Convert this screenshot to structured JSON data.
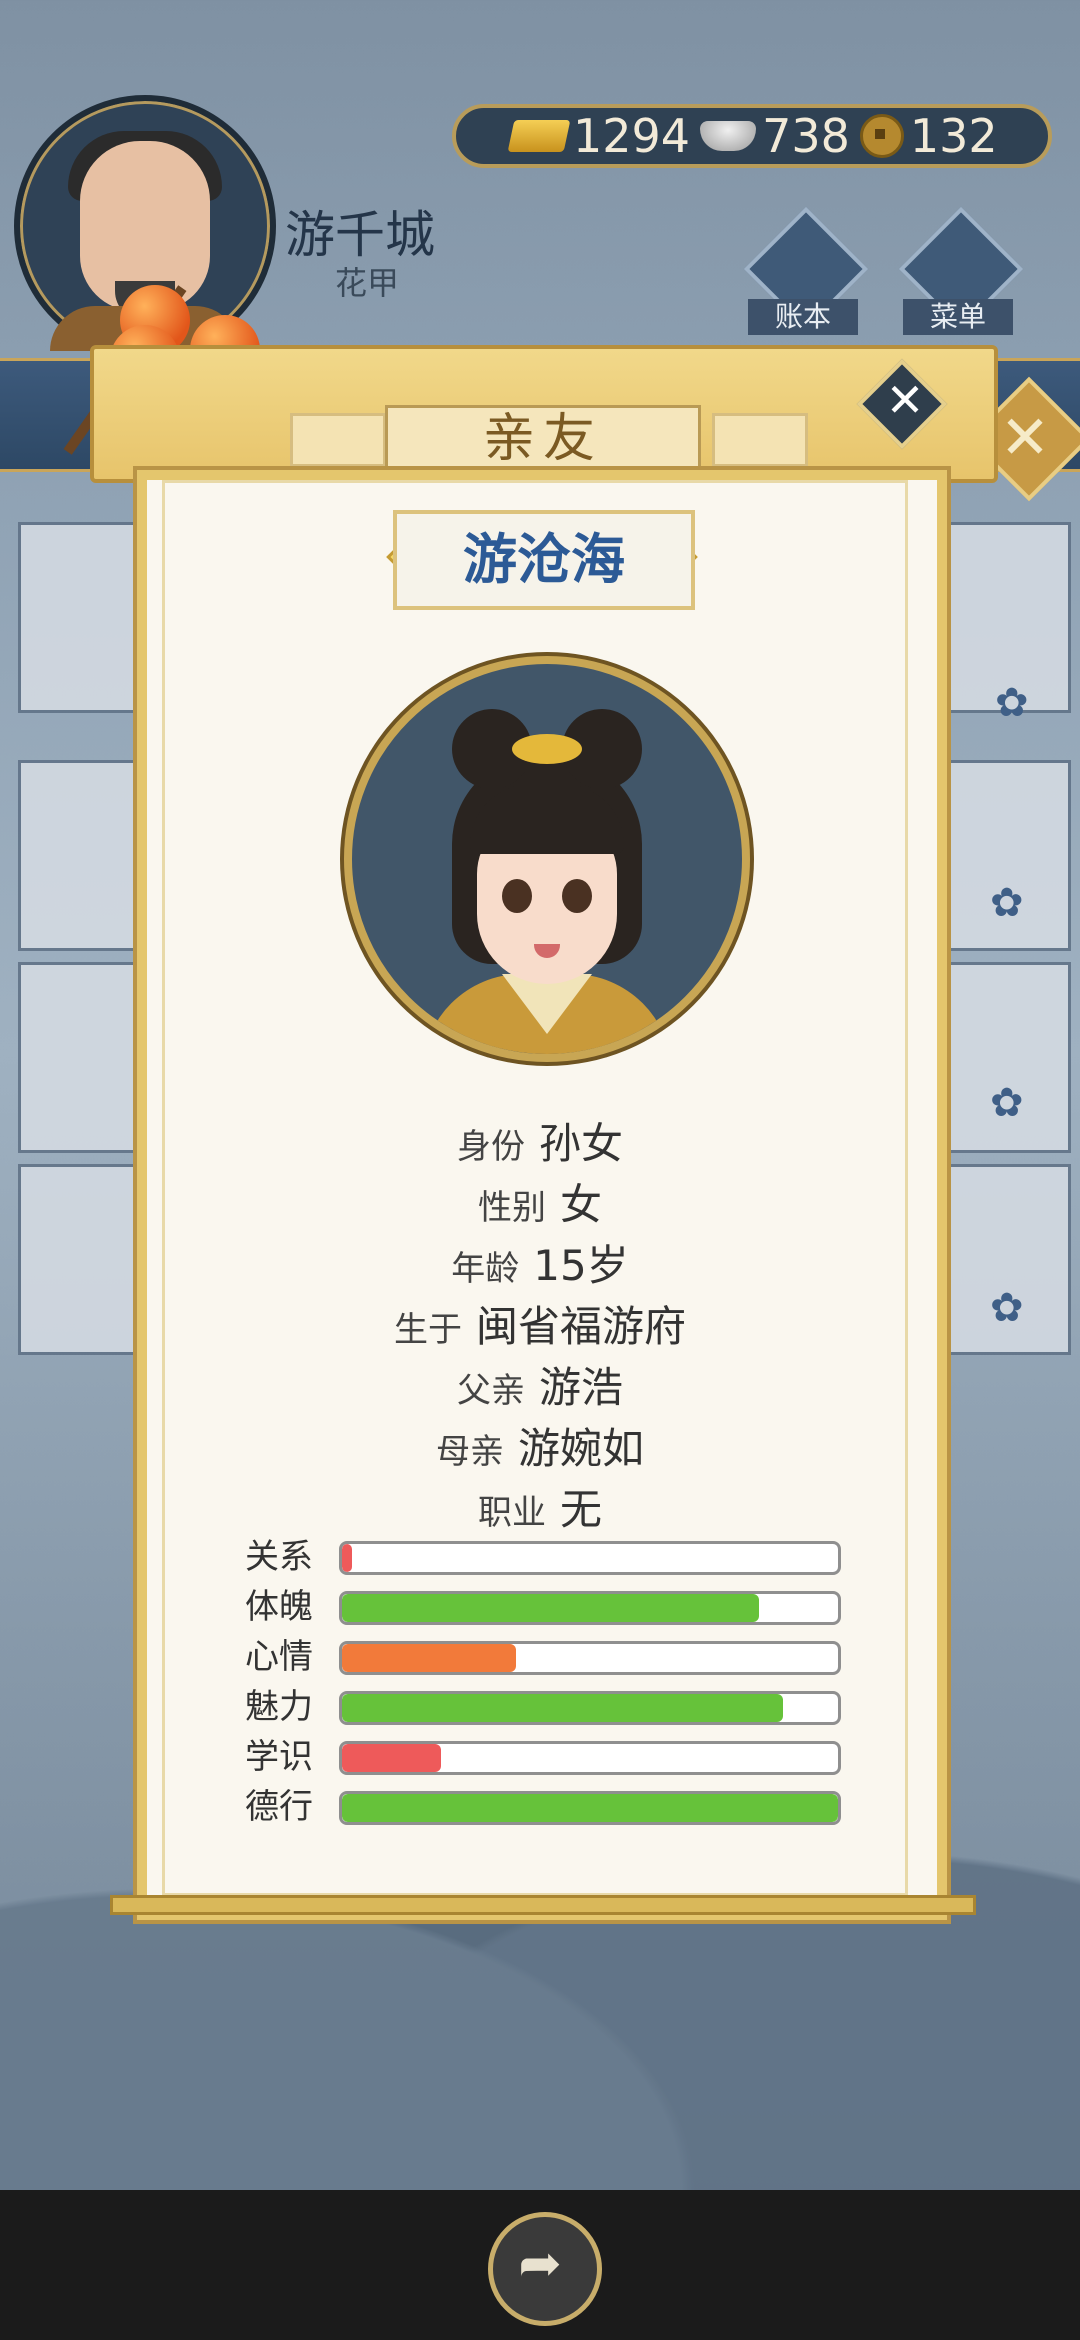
{
  "player": {
    "name": "游千城",
    "title": "花甲"
  },
  "currency": {
    "gold": "1294",
    "silver": "738",
    "coin": "132"
  },
  "top_buttons": {
    "ledger": "账本",
    "menu": "菜单"
  },
  "dialog": {
    "tab_title": "亲友",
    "person_name": "游沧海",
    "info": [
      {
        "key": "身份",
        "value": "孙女"
      },
      {
        "key": "性别",
        "value": "女"
      },
      {
        "key": "年龄",
        "value": "15岁"
      },
      {
        "key": "生于",
        "value": "闽省福游府"
      },
      {
        "key": "父亲",
        "value": "游浩"
      },
      {
        "key": "母亲",
        "value": "游婉如"
      },
      {
        "key": "职业",
        "value": "无"
      }
    ],
    "stats": [
      {
        "label": "关系",
        "value": 0.02,
        "color": "#ee5a5a"
      },
      {
        "label": "体魄",
        "value": 0.84,
        "color": "#66c23a"
      },
      {
        "label": "心情",
        "value": 0.35,
        "color": "#f27a3a"
      },
      {
        "label": "魅力",
        "value": 0.89,
        "color": "#66c23a"
      },
      {
        "label": "学识",
        "value": 0.2,
        "color": "#ee5a5a"
      },
      {
        "label": "德行",
        "value": 1.0,
        "color": "#66c23a"
      }
    ]
  }
}
